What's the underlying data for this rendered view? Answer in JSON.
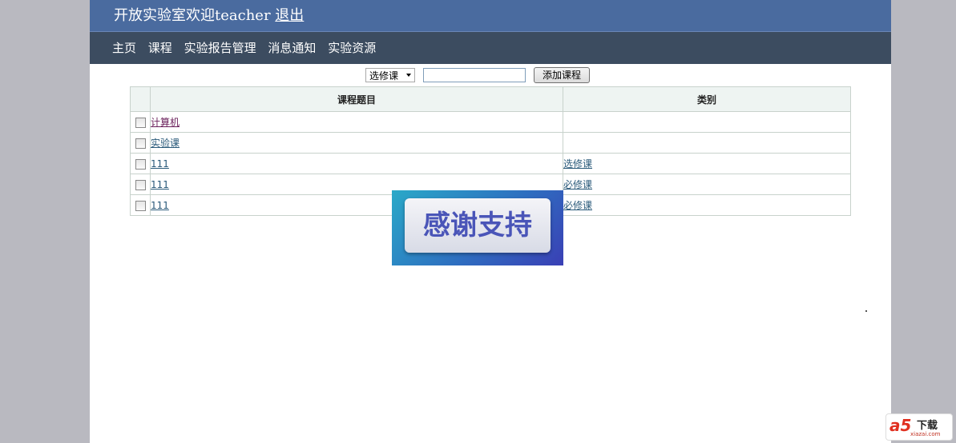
{
  "header": {
    "title": "开放实验室欢迎teacher",
    "logout_label": "退出"
  },
  "nav": {
    "items": [
      {
        "label": "主页"
      },
      {
        "label": "课程"
      },
      {
        "label": "实验报告管理"
      },
      {
        "label": "消息通知"
      },
      {
        "label": "实验资源"
      }
    ]
  },
  "toolbar": {
    "select_value": "选修课",
    "input_value": "",
    "add_label": "添加课程"
  },
  "table": {
    "columns": [
      "课程题目",
      "类别"
    ],
    "rows": [
      {
        "title": "计算机",
        "category": ""
      },
      {
        "title": "实验课",
        "category": ""
      },
      {
        "title": "111",
        "category": "选修课"
      },
      {
        "title": "111",
        "category": "必修课"
      },
      {
        "title": "111",
        "category": "必修课"
      }
    ]
  },
  "banner": {
    "text": "感谢支持"
  },
  "watermark": {
    "mark": "a5",
    "text": "下载",
    "sub": "xiazai.com"
  }
}
